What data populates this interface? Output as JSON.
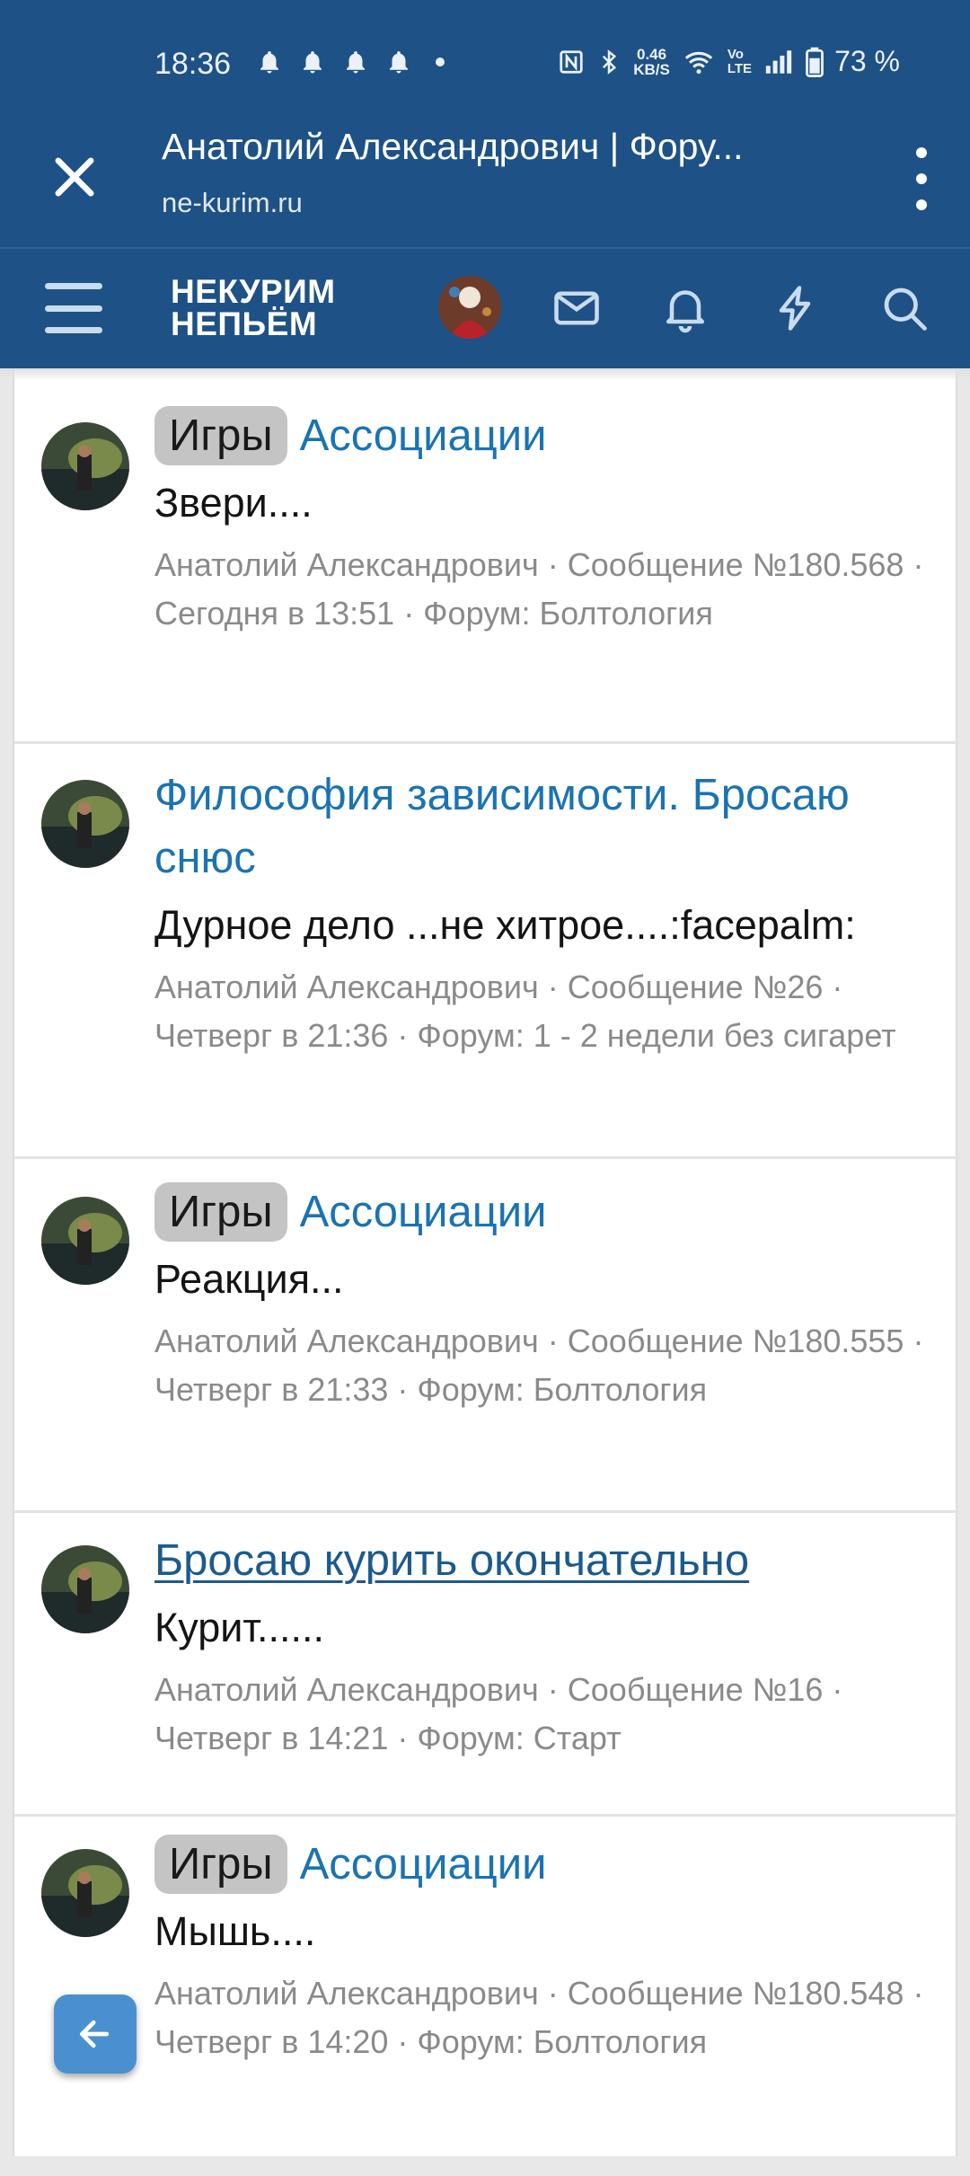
{
  "status_bar": {
    "time": "18:36",
    "net_speed_value": "0.46",
    "net_speed_unit": "KB/S",
    "volte_top": "Vo",
    "volte_bottom": "LTE",
    "battery": "73 %"
  },
  "tab": {
    "title": "Анатолий Александрович | Фору...",
    "url": "ne-kurim.ru"
  },
  "site": {
    "logo_line1": "НЕКУРИМ",
    "logo_line2": "НЕПЬЁМ"
  },
  "colors": {
    "brand": "#1e5186",
    "link": "#1a73b3",
    "prefix_bg": "#c4c4c4",
    "meta": "#8a8a8a"
  },
  "items": [
    {
      "prefix": "Игры",
      "title": "Ассоциации",
      "snippet": "Звери....",
      "meta": "Анатолий Александрович · Сообщение №180.568 · Сегодня в 13:51 · Форум: Болтология"
    },
    {
      "prefix": "",
      "title": "Философия зависимости. Бросаю снюс",
      "snippet": "Дурное дело ...не хитрое....:facepalm:",
      "meta": "Анатолий Александрович · Сообщение №26 · Четверг в 21:36 · Форум: 1 - 2 недели без сигарет"
    },
    {
      "prefix": "Игры",
      "title": "Ассоциации",
      "snippet": "Реакция...",
      "meta": "Анатолий Александрович · Сообщение №180.555 · Четверг в 21:33 · Форум: Болтология"
    },
    {
      "prefix": "",
      "title": "Бросаю курить окончательно",
      "snippet": "Курит......",
      "meta": "Анатолий Александрович · Сообщение №16 · Четверг в 14:21 · Форум: Старт"
    },
    {
      "prefix": "Игры",
      "title": "Ассоциации",
      "snippet": "Мышь....",
      "meta": "Анатолий Александрович · Сообщение №180.548 · Четверг в 14:20 · Форум: Болтология"
    }
  ],
  "icons": {
    "close": "close-icon",
    "menu": "kebab-menu-icon",
    "hamburger": "hamburger-icon",
    "inbox": "envelope-icon",
    "alerts": "bell-icon",
    "whats_new": "lightning-icon",
    "search": "search-icon",
    "back": "arrow-left-icon"
  }
}
